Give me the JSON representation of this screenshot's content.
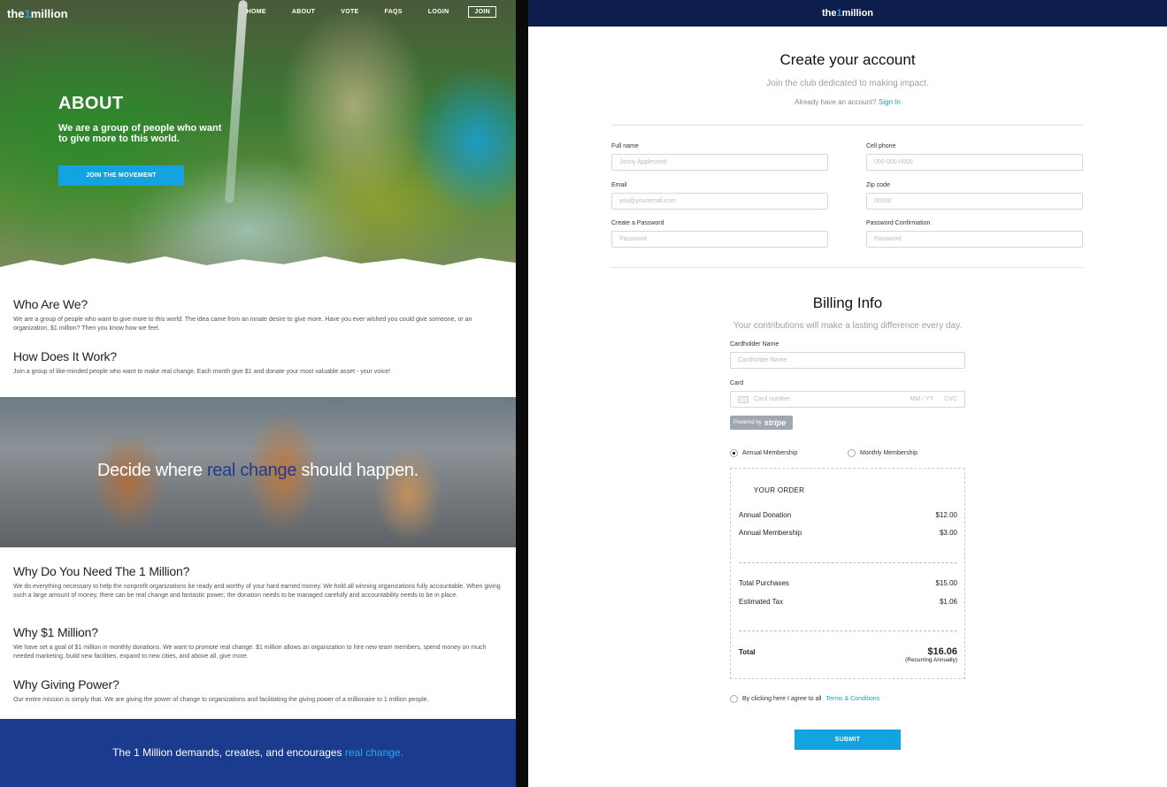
{
  "brand": {
    "pre": "the",
    "one": "1",
    "post": "million"
  },
  "nav": {
    "items": [
      "HOME",
      "ABOUT",
      "VOTE",
      "FAQS",
      "LOGIN"
    ],
    "join": "JOIN"
  },
  "hero": {
    "title": "ABOUT",
    "subtitle": "We are a group of people who want to give more to this world.",
    "cta": "JOIN THE MOVEMENT"
  },
  "sections_top": [
    {
      "heading": "Who Are We?",
      "body": "We are a group of people who want to give more to this world. The idea came from an innate desire to give more. Have you ever wished you could give someone, or an organization, $1 million? Then you know how we feel."
    },
    {
      "heading": "How Does It Work?",
      "body": "Join a group of like-minded people who want to make real change. Each month give $1 and donate your most valuable asset - your voice!"
    }
  ],
  "banner": {
    "pre": "Decide where ",
    "highlight": "real change",
    "post": " should happen."
  },
  "sections_bottom": [
    {
      "heading": "Why Do You Need The 1 Million?",
      "body": "We do everything necessary to help the nonprofit organizations be ready and worthy of your hard earned money. We hold all winning organizations fully accountable. When giving such a large amount of money, there can be real change and fantastic power; the donation needs to be managed carefully and accountability needs to be in place."
    },
    {
      "heading": "Why $1 Million?",
      "body": "We have set a goal of $1 million in monthly donations. We want to promote real change. $1 million allows an organization to hire new team members, spend money on much needed marketing, build new facilities, expand to new cities, and above all, give more."
    },
    {
      "heading": "Why Giving Power?",
      "body": "Our entire mission is simply that. We are giving the power of change to organizations and facilitating the giving power of a millionaire to 1 million people."
    }
  ],
  "footer": {
    "pre": "The 1 Million demands, creates, and encourages ",
    "highlight": "real change."
  },
  "signup": {
    "title": "Create your account",
    "subtitle": "Join the club dedicated to making impact.",
    "have_account": "Already have an account?",
    "sign_in": "Sign In",
    "fields": {
      "full_name": {
        "label": "Full name",
        "placeholder": "Jonny Appleseed"
      },
      "cell_phone": {
        "label": "Cell phone",
        "placeholder": "000-000-0000"
      },
      "email": {
        "label": "Email",
        "placeholder": "you@youremail.com"
      },
      "zip": {
        "label": "Zip code",
        "placeholder": "00000"
      },
      "password": {
        "label": "Create a Password",
        "placeholder": "Password"
      },
      "password_confirm": {
        "label": "Password Confirmation",
        "placeholder": "Password"
      }
    }
  },
  "billing": {
    "title": "Billing Info",
    "subtitle": "Your contributions will make a lasting difference every day.",
    "cardholder": {
      "label": "Cardholder Name",
      "placeholder": "Cardholder Name"
    },
    "card": {
      "label": "Card",
      "placeholder": "Card number",
      "exp": "MM / YY",
      "cvc": "CVC"
    },
    "stripe": {
      "pre": "Powered by",
      "name": "stripe"
    },
    "membership": {
      "annual": "Annual Membership",
      "monthly": "Monthly Membership",
      "selected": "annual"
    }
  },
  "order": {
    "title": "YOUR ORDER",
    "lines": [
      {
        "label": "Annual Donation",
        "amount": "$12.00"
      },
      {
        "label": "Annual Membership",
        "amount": "$3.00"
      }
    ],
    "subtotals": [
      {
        "label": "Total Purchases",
        "amount": "$15.00"
      },
      {
        "label": "Estimated Tax",
        "amount": "$1.06"
      }
    ],
    "total_label": "Total",
    "total_amount": "$16.06",
    "recurring": "(Recurring Annually)"
  },
  "agree": {
    "pre": "By clicking here I agree to all",
    "link": "Terms & Conditions"
  },
  "submit": "SUBMIT",
  "colors": {
    "accent": "#13a3e0",
    "navy": "#0d1e4c",
    "band": "#1b3b8e"
  }
}
